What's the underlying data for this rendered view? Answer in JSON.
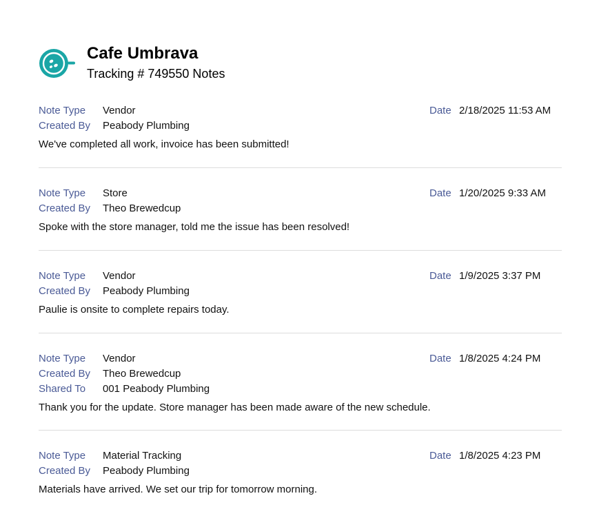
{
  "header": {
    "company": "Cafe Umbrava",
    "subtitle": "Tracking # 749550 Notes",
    "logo_icon": "coffee-cup-icon",
    "brand_color": "#1aa6a6"
  },
  "labels": {
    "note_type": "Note Type",
    "created_by": "Created By",
    "shared_to": "Shared To",
    "date": "Date"
  },
  "notes": [
    {
      "note_type": "Vendor",
      "created_by": "Peabody Plumbing",
      "date": "2/18/2025 11:53 AM",
      "text": "We've completed all work, invoice has been submitted!"
    },
    {
      "note_type": "Store",
      "created_by": "Theo Brewedcup",
      "date": "1/20/2025 9:33 AM",
      "text": "Spoke with the store manager, told me the issue has been resolved!"
    },
    {
      "note_type": "Vendor",
      "created_by": "Peabody Plumbing",
      "date": "1/9/2025 3:37 PM",
      "text": "Paulie is onsite to complete repairs today."
    },
    {
      "note_type": "Vendor",
      "created_by": "Theo Brewedcup",
      "shared_to": "001 Peabody Plumbing",
      "date": "1/8/2025 4:24 PM",
      "text": "Thank you for the update. Store manager has been made aware of the new schedule."
    },
    {
      "note_type": "Material Tracking",
      "created_by": "Peabody Plumbing",
      "date": "1/8/2025 4:23 PM",
      "text": "Materials have arrived. We set our trip for tomorrow morning."
    }
  ]
}
